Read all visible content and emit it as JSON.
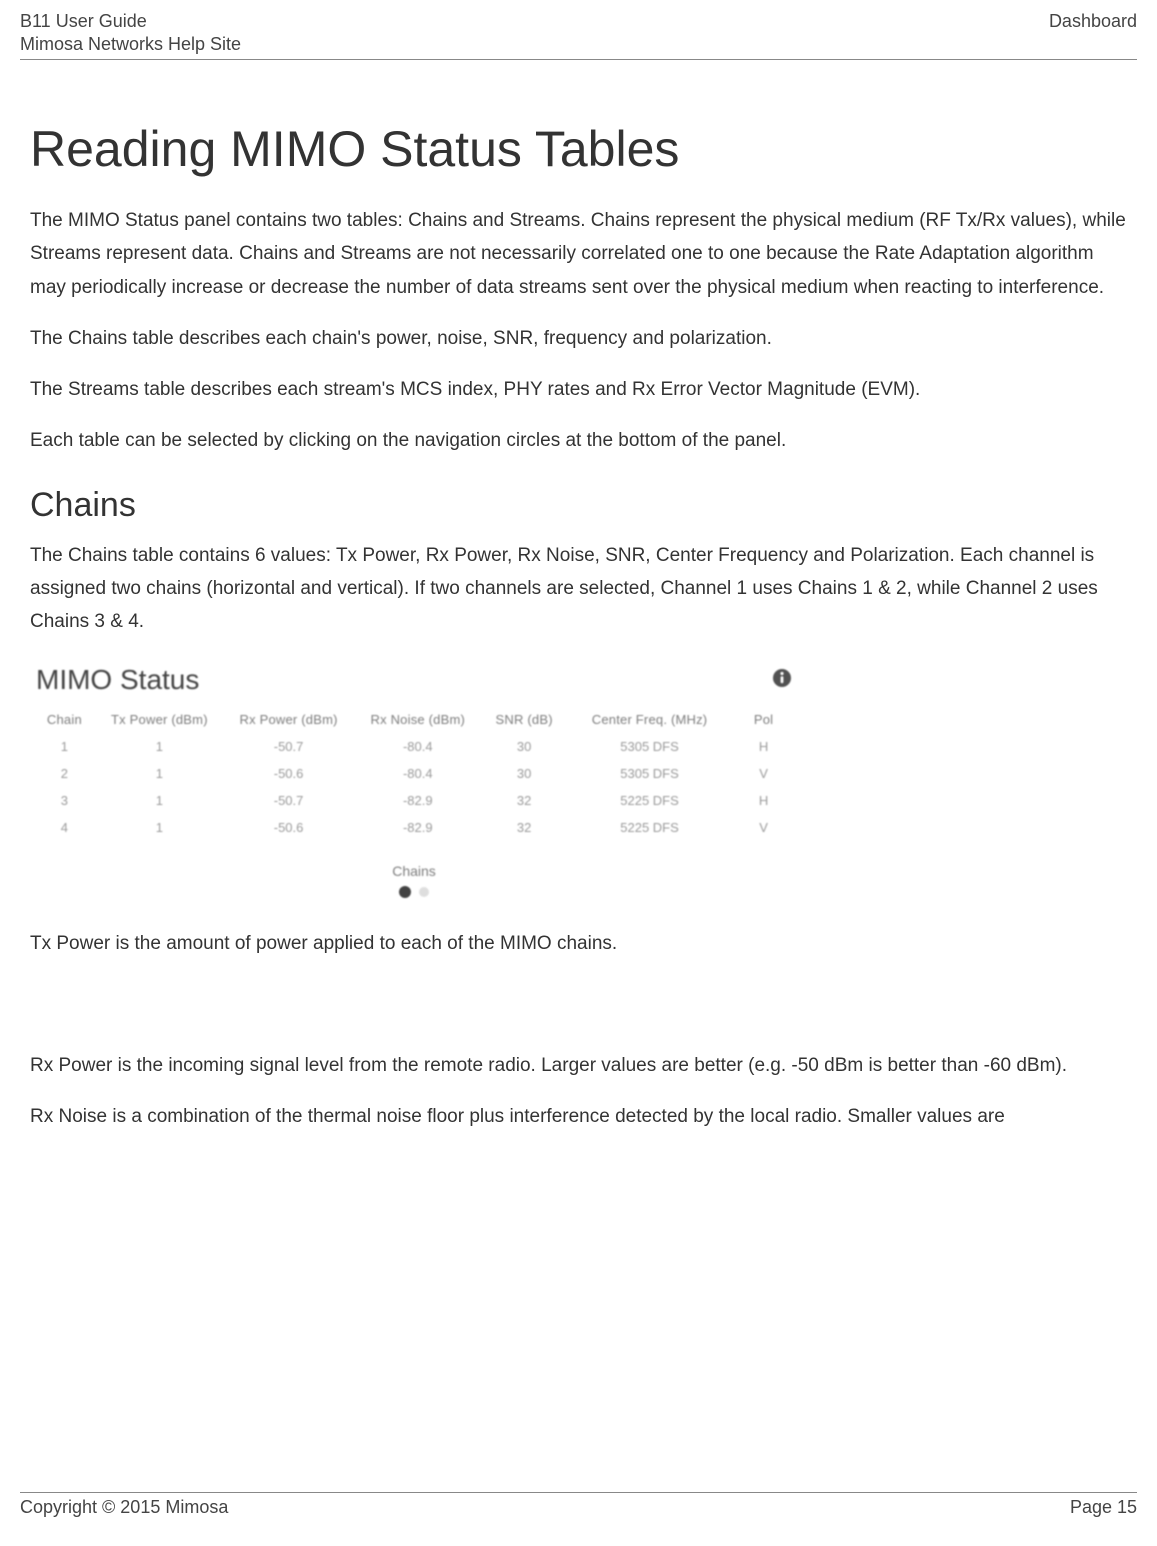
{
  "header": {
    "title_l1": "B11 User Guide",
    "title_l2": "Mimosa Networks Help Site",
    "right": "Dashboard"
  },
  "main": {
    "h1": "Reading MIMO Status Tables",
    "p1": "The MIMO Status panel contains two tables: Chains and Streams. Chains represent the physical medium (RF Tx/Rx values), while Streams represent data. Chains and Streams are not necessarily correlated one to one because the Rate Adaptation algorithm may periodically increase or decrease the number of data streams sent over the physical medium when reacting to interference.",
    "p2": "The Chains table describes each chain's power, noise, SNR, frequency and polarization.",
    "p3": "The Streams table describes each stream's MCS index, PHY rates and Rx Error Vector Magnitude (EVM).",
    "p4": "Each table can be selected by clicking on the navigation circles at the bottom of the panel.",
    "h2": "Chains",
    "p5": "The Chains table contains 6 values: Tx Power, Rx Power, Rx Noise, SNR, Center Frequency and Polarization.  Each channel is assigned two chains (horizontal and vertical). If two channels are selected, Channel 1 uses Chains 1 & 2, while Channel 2 uses Chains 3 & 4.",
    "p6": "Tx Power is the amount of power applied to each of the MIMO chains.",
    "p7": "Rx Power is the incoming signal level from the remote radio. Larger values are better (e.g. -50 dBm is better than -60 dBm).",
    "p8": "Rx Noise is a combination of the thermal noise floor plus interference detected by the local radio. Smaller values are"
  },
  "panel": {
    "title": "MIMO Status",
    "nav_label": "Chains",
    "cols": {
      "c0": "Chain",
      "c1": "Tx Power (dBm)",
      "c2": "Rx Power (dBm)",
      "c3": "Rx Noise (dBm)",
      "c4": "SNR (dB)",
      "c5": "Center Freq. (MHz)",
      "c6": "Pol"
    },
    "rows": [
      {
        "chain": "1",
        "tx": "1",
        "rx": "-50.7",
        "noise": "-80.4",
        "snr": "30",
        "freq": "5305 DFS",
        "pol": "H"
      },
      {
        "chain": "2",
        "tx": "1",
        "rx": "-50.6",
        "noise": "-80.4",
        "snr": "30",
        "freq": "5305 DFS",
        "pol": "V"
      },
      {
        "chain": "3",
        "tx": "1",
        "rx": "-50.7",
        "noise": "-82.9",
        "snr": "32",
        "freq": "5225 DFS",
        "pol": "H"
      },
      {
        "chain": "4",
        "tx": "1",
        "rx": "-50.6",
        "noise": "-82.9",
        "snr": "32",
        "freq": "5225 DFS",
        "pol": "V"
      }
    ]
  },
  "footer": {
    "left": "Copyright © 2015 Mimosa",
    "right": "Page 15"
  },
  "chart_data": {
    "type": "table",
    "title": "MIMO Status – Chains",
    "columns": [
      "Chain",
      "Tx Power (dBm)",
      "Rx Power (dBm)",
      "Rx Noise (dBm)",
      "SNR (dB)",
      "Center Freq. (MHz)",
      "Pol"
    ],
    "rows": [
      [
        1,
        1,
        -50.7,
        -80.4,
        30,
        "5305 DFS",
        "H"
      ],
      [
        2,
        1,
        -50.6,
        -80.4,
        30,
        "5305 DFS",
        "V"
      ],
      [
        3,
        1,
        -50.7,
        -82.9,
        32,
        "5225 DFS",
        "H"
      ],
      [
        4,
        1,
        -50.6,
        -82.9,
        32,
        "5225 DFS",
        "V"
      ]
    ]
  }
}
